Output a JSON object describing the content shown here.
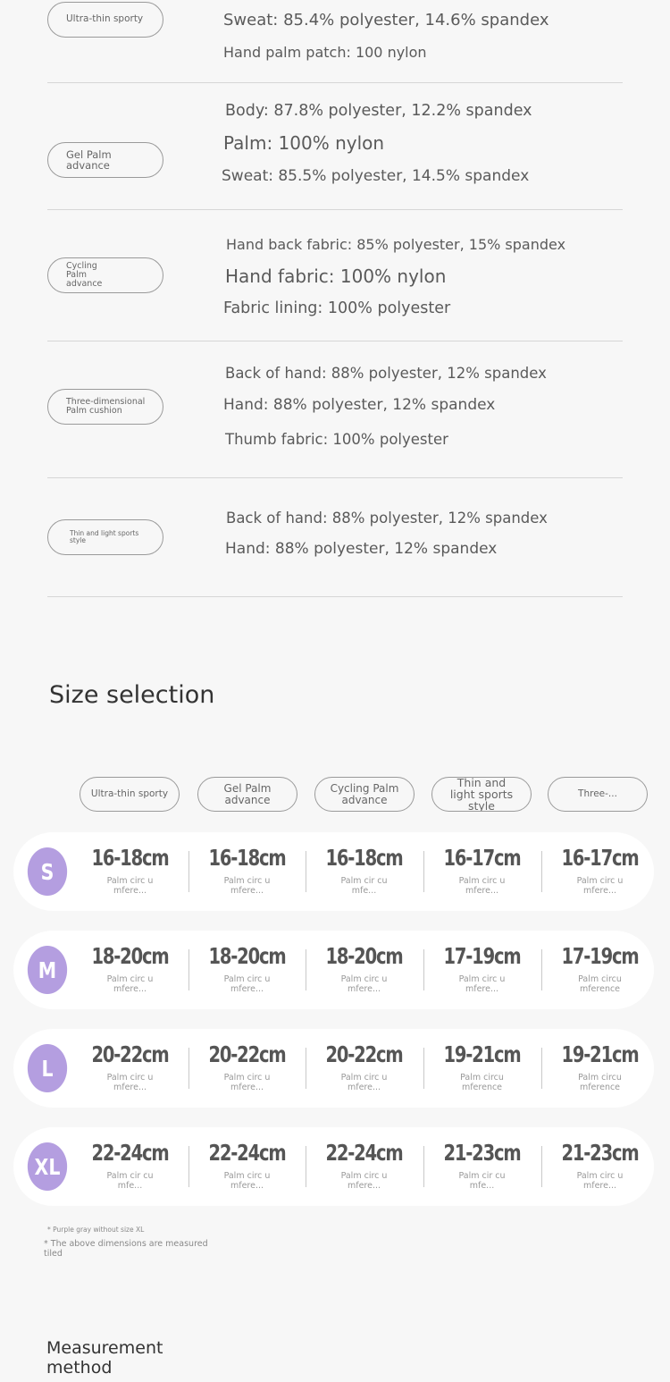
{
  "materials": [
    {
      "name": "Ultra-thin sporty",
      "lines": [
        "Sweat: 85.4% polyester, 14.6% spandex",
        "Hand palm patch: 100 nylon"
      ]
    },
    {
      "name": "Gel Palm advance",
      "lines": [
        "Body: 87.8% polyester, 12.2% spandex",
        "Palm: 100% nylon",
        "Sweat: 85.5% polyester, 14.5% spandex"
      ]
    },
    {
      "name": "Cycling Palm advance",
      "lines": [
        "Hand back fabric: 85% polyester, 15% spandex",
        "Hand fabric: 100% nylon",
        "Fabric lining: 100% polyester"
      ]
    },
    {
      "name": "Three-dimensional Palm cushion",
      "lines": [
        "Back of hand: 88% polyester, 12% spandex",
        "Hand: 88% polyester, 12% spandex",
        "Thumb fabric: 100% polyester"
      ]
    },
    {
      "name": "Thin and light sports style",
      "lines": [
        "Back of hand: 88% polyester, 12% spandex",
        "Hand: 88% polyester, 12% spandex"
      ]
    }
  ],
  "size_section": {
    "title": "Size selection",
    "columns": [
      "Ultra-thin sporty",
      "Gel Palm advance",
      "Cycling Palm advance",
      "Thin and light sports style",
      "Three-..."
    ],
    "rows": [
      {
        "size": "S",
        "values": [
          "16-18cm",
          "16-18cm",
          "16-18cm",
          "16-17cm",
          "16-17cm"
        ],
        "subs": [
          "Palm circ umfere...",
          "Palm circ umfere...",
          "Palm cir cumfe...",
          "Palm circ umfere...",
          "Palm circ umfere..."
        ]
      },
      {
        "size": "M",
        "values": [
          "18-20cm",
          "18-20cm",
          "18-20cm",
          "17-19cm",
          "17-19cm"
        ],
        "subs": [
          "Palm circ umfere...",
          "Palm circ umfere...",
          "Palm circ umfere...",
          "Palm circ umfere...",
          "Palm circu mference"
        ]
      },
      {
        "size": "L",
        "values": [
          "20-22cm",
          "20-22cm",
          "20-22cm",
          "19-21cm",
          "19-21cm"
        ],
        "subs": [
          "Palm circ umfere...",
          "Palm circ umfere...",
          "Palm circ umfere...",
          "Palm circu mference",
          "Palm circu mference"
        ]
      },
      {
        "size": "XL",
        "values": [
          "22-24cm",
          "22-24cm",
          "22-24cm",
          "21-23cm",
          "21-23cm"
        ],
        "subs": [
          "Palm cir cumfe...",
          "Palm circ umfere...",
          "Palm circ umfere...",
          "Palm cir cumfe...",
          "Palm circ umfere..."
        ]
      }
    ],
    "notes": [
      "* Purple gray without size XL",
      "* The above dimensions are measured tiled"
    ]
  },
  "method_title": "Measurement method",
  "colors": {
    "badge": "#b49ee0",
    "row_bg": "#ffffff",
    "page_bg": "#f7f7f7"
  }
}
